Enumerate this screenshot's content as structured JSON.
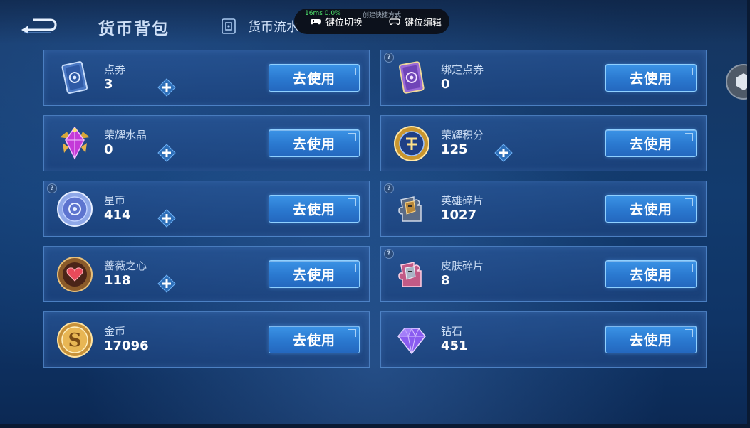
{
  "header": {
    "title": "货币背包",
    "flow_tab_label": "货币流水"
  },
  "overlay": {
    "fps_text": "16ms 0.0%",
    "shortcut_text": "创建快捷方式",
    "switch_label": "键位切换",
    "edit_label": "键位编辑"
  },
  "use_label": "去使用",
  "question_mark": "?",
  "left_items": [
    {
      "name": "点券",
      "amount": "3",
      "icon": "voucher-card-icon"
    },
    {
      "name": "荣耀水晶",
      "amount": "0",
      "icon": "glory-crystal-icon"
    },
    {
      "name": "星币",
      "amount": "414",
      "icon": "star-coin-icon"
    },
    {
      "name": "蔷薇之心",
      "amount": "118",
      "icon": "rose-heart-icon"
    },
    {
      "name": "金币",
      "amount": "17096",
      "icon": "gold-coin-icon"
    }
  ],
  "right_items": [
    {
      "name": "绑定点券",
      "amount": "0",
      "icon": "bound-voucher-icon"
    },
    {
      "name": "荣耀积分",
      "amount": "125",
      "icon": "glory-points-icon"
    },
    {
      "name": "英雄碎片",
      "amount": "1027",
      "icon": "hero-fragment-icon"
    },
    {
      "name": "皮肤碎片",
      "amount": "8",
      "icon": "skin-fragment-icon"
    },
    {
      "name": "钻石",
      "amount": "451",
      "icon": "diamond-icon"
    }
  ],
  "colors": {
    "button_blue": "#2a78cf",
    "card_border": "#6eaaf0",
    "background": "#123b6e"
  }
}
